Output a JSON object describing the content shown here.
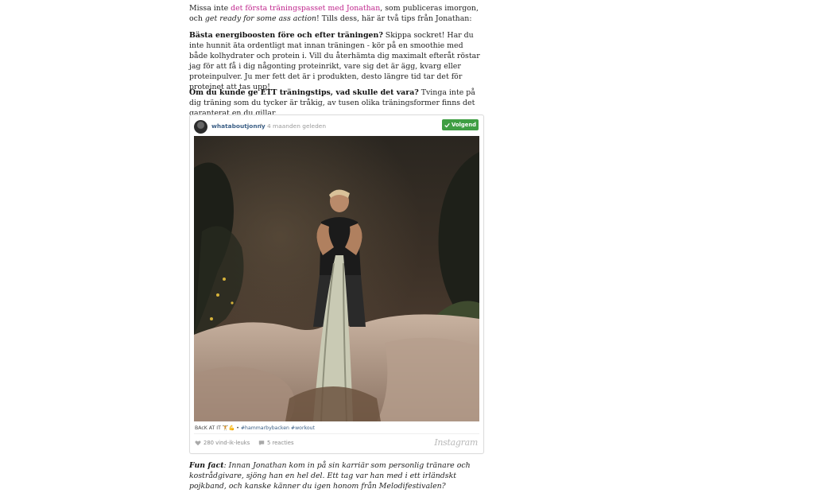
{
  "article": {
    "p1": {
      "before": "Missa inte ",
      "link": "det första träningspasset med Jonathan",
      "middle": ", som publiceras imorgon, och ",
      "italic": "get ready for some ass action",
      "after": "! Tills dess, här är två tips från Jonathan:"
    },
    "p2": {
      "bold": "Bästa energiboosten före och efter träningen?",
      "text": " Skippa sockret! Har du inte hunnit äta ordentligt mat innan träningen - kör på en smoothie med både kolhydrater och protein i. Vill du återhämta dig maximalt efteråt röstar jag för att få i dig någonting proteinrikt, vare sig det är ägg, kvarg eller proteinpulver. Ju mer fett det är i produkten, desto längre tid tar det för proteinet att tas upp!"
    },
    "p3": {
      "bold": "Om du kunde ge ETT träningstips, vad skulle det vara?",
      "text": " Tvinga inte på dig träning som du tycker är tråkig, av tusen olika träningsformer finns det garanterat en du gillar."
    },
    "p4": {
      "bold": "Fun fact",
      "text": ": Innan Jonathan kom in på sin karriär som personlig tränare och kostrådgivare, sjöng han en hel del. Ett tag var han med i ett irländskt pojkband, och kanske känner du igen honom från Melodifestivalen?"
    }
  },
  "instagram": {
    "username": "whataboutjonny",
    "separator": "•",
    "age": "4 maanden geleden",
    "follow_label": "Volgend",
    "caption_prefix": "BAcK AT IT 🏋️💪 • ",
    "hashtags": "#hammarbybacken #workout",
    "likes": "280 vind-ik-leuks",
    "comments": "5 reacties",
    "logo": "Instagram",
    "icons": {
      "avatar": "profile-photo",
      "check": "check-icon",
      "like": "heart-icon",
      "comment": "comment-bubble-icon"
    },
    "accent": "#3f9e43"
  }
}
